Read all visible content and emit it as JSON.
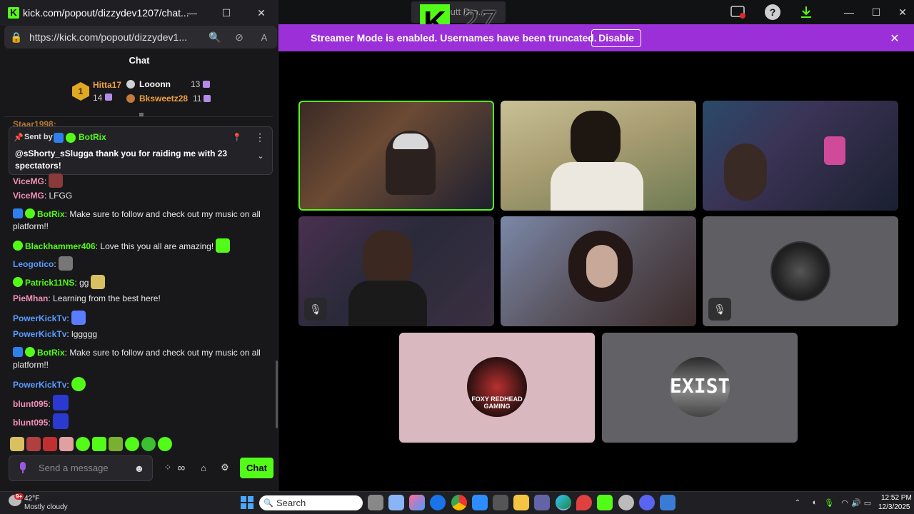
{
  "popout": {
    "title": "kick.com/popout/dizzydev1207/chat...",
    "url": "https://kick.com/popout/dizzydev1...",
    "chat_header": "Chat",
    "leaderboard": {
      "rank": "1",
      "first": {
        "name": "Hitta17",
        "count": "14"
      },
      "second": {
        "name": "Looonn",
        "count": "13"
      },
      "third": {
        "name": "Bksweetz28",
        "count": "11"
      }
    },
    "pinned": {
      "sent_by": "Sent by",
      "author": "BotRix",
      "text": "@sShorty_sSlugga thank you for raiding me with 23 spectators!"
    },
    "partial_user": "Staar1998:",
    "messages": [
      {
        "user": "ViceMG",
        "text": ""
      },
      {
        "user": "ViceMG",
        "text": "LFGG"
      },
      {
        "user": "BotRix",
        "text": "Make sure to follow and check out my music on all platform!!"
      },
      {
        "user": "Blackhammer406",
        "text": "Love this you all are amazing!"
      },
      {
        "user": "Leogotico",
        "text": ""
      },
      {
        "user": "Patrick11NS",
        "text": "gg"
      },
      {
        "user": "PieMhan",
        "text": "Learning from the best here!"
      },
      {
        "user": "PowerKickTv",
        "text": ""
      },
      {
        "user": "PowerKickTv",
        "text": "lggggg"
      },
      {
        "user": "BotRix",
        "text": "Make sure to follow and check out my music on all platform!!"
      },
      {
        "user": "PowerKickTv",
        "text": ""
      },
      {
        "user": "blunt095",
        "text": ""
      },
      {
        "user": "blunt095",
        "text": ""
      }
    ],
    "input_placeholder": "Send a message",
    "send_label": "Chat"
  },
  "banner": {
    "text": "Streamer Mode is enabled. Usernames have been truncated.",
    "disable_label": "Disable"
  },
  "overlay": {
    "k_text": "K",
    "num_text": "27",
    "ghost": "Butt Dro..."
  },
  "tiles": [
    {
      "label": "video-1",
      "highlighted": true
    },
    {
      "label": "video-2"
    },
    {
      "label": "video-3"
    },
    {
      "label": "video-4",
      "muted": true
    },
    {
      "label": "video-5"
    },
    {
      "label": "video-6",
      "muted": true
    },
    {
      "label": "foxy",
      "logo": "FOXY REDHEAD GAMING"
    },
    {
      "label": "exist",
      "logo": "EXIST"
    }
  ],
  "taskbar": {
    "weather_temp": "42°F",
    "weather_desc": "Mostly cloudy",
    "weather_badge": "9+",
    "search": "Search",
    "time": "12:52 PM",
    "date": "12/3/2025"
  },
  "colors": {
    "kick_green": "#53fc18",
    "banner_purple": "#9b30d9",
    "highlight_border": "#53fc18"
  }
}
